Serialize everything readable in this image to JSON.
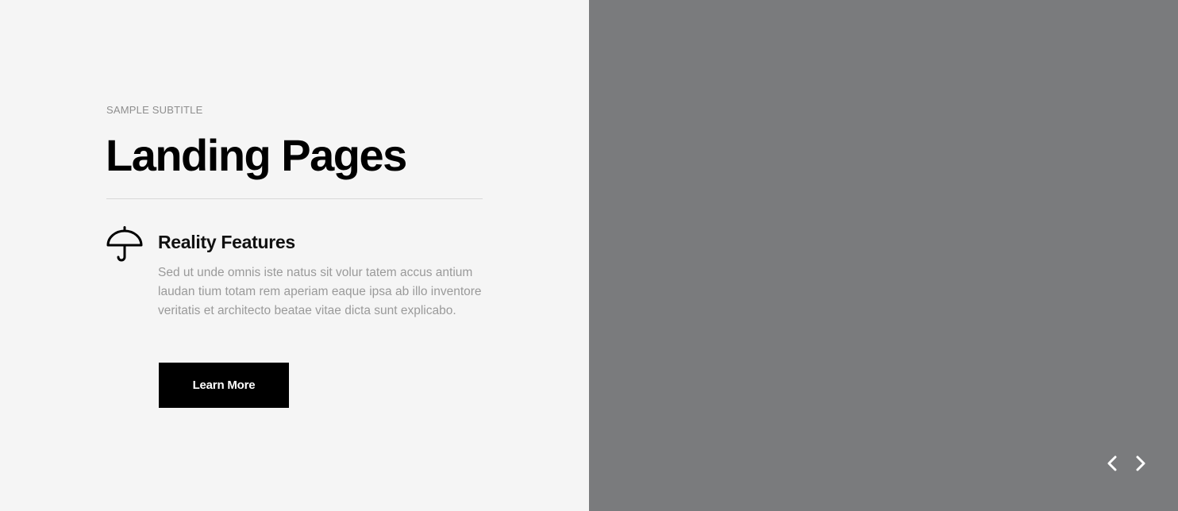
{
  "hero": {
    "subtitle": "SAMPLE SUBTITLE",
    "title": "Landing Pages"
  },
  "feature": {
    "icon": "umbrella-icon",
    "title": "Reality Features",
    "text": "Sed ut unde omnis iste natus sit volur tatem accus antium laudan tium totam rem aperiam eaque ipsa ab illo inventore veritatis et architecto beatae vitae dicta sunt explicabo."
  },
  "cta": {
    "label": "Learn More"
  },
  "slider": {
    "prev_icon": "chevron-left-icon",
    "next_icon": "chevron-right-icon"
  },
  "colors": {
    "left_background": "#f5f5f5",
    "right_background": "#7a7b7d",
    "button_background": "#000000",
    "button_text": "#ffffff",
    "body_text": "#9a9a9a"
  }
}
